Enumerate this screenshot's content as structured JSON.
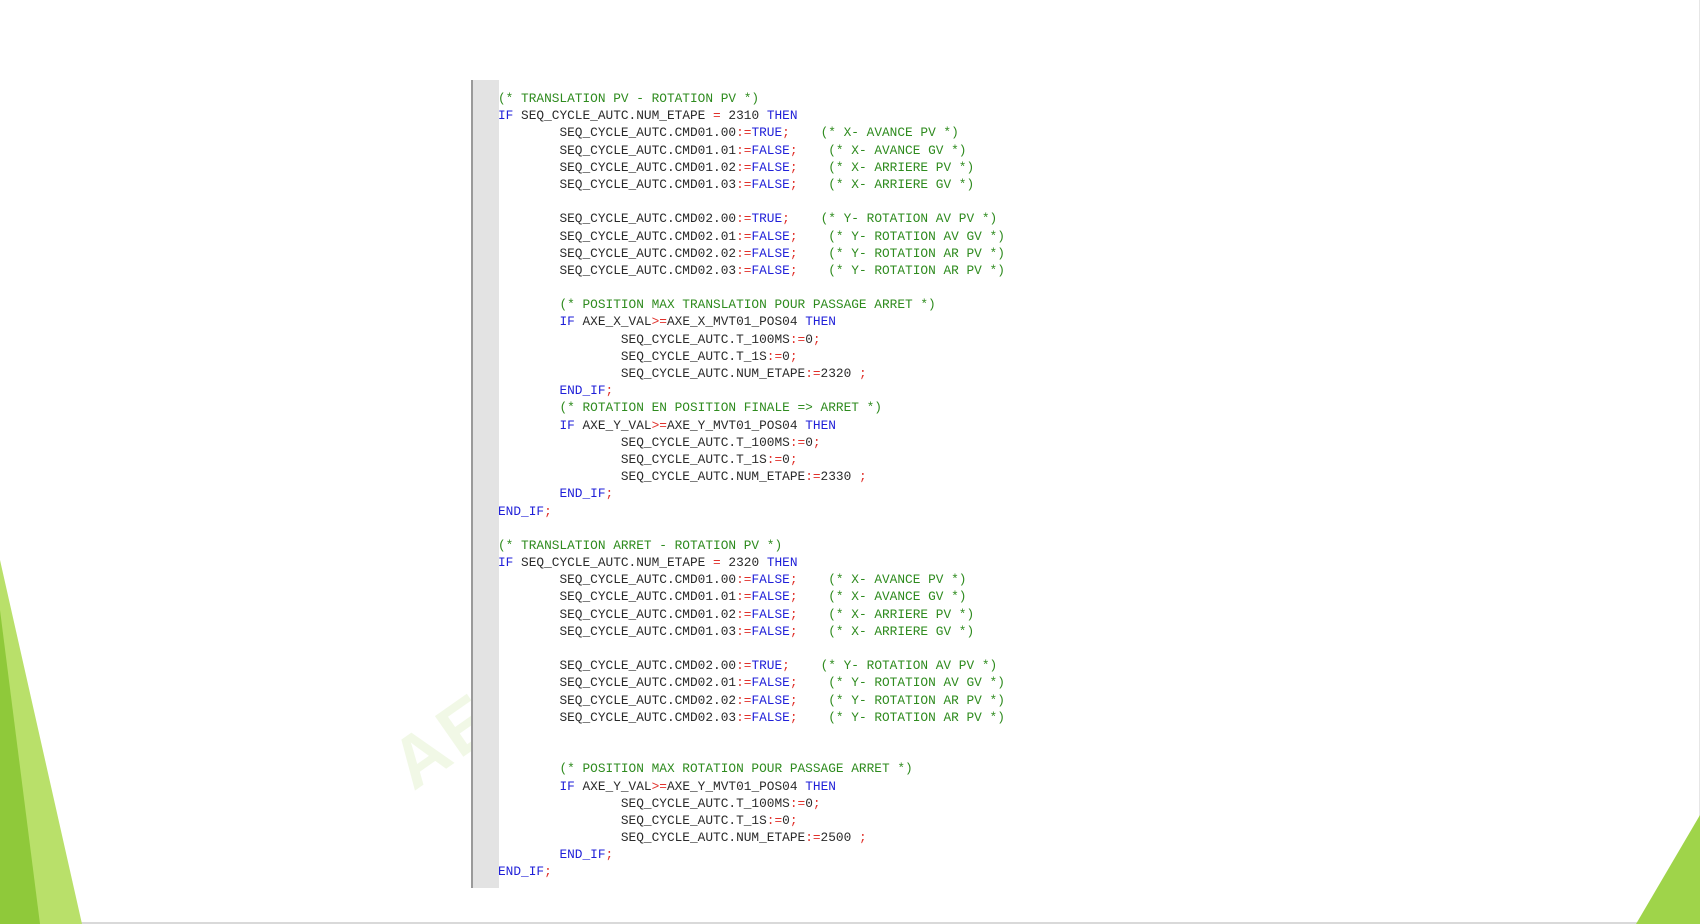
{
  "colors": {
    "comment": "#2e8b1e",
    "keyword": "#1f1fd8",
    "identifier": "#2a2a2a",
    "operator": "#e0302a",
    "accent_green": "#8fc93a",
    "gutter": "#e3e3e3"
  },
  "watermark": "AE",
  "code_lines": [
    {
      "tokens": [
        {
          "t": "cm",
          "v": "(* TRANSLATION PV - ROTATION PV *)"
        }
      ]
    },
    {
      "tokens": [
        {
          "t": "kw",
          "v": "IF"
        },
        {
          "t": "ws",
          "v": " "
        },
        {
          "t": "id",
          "v": "SEQ_CYCLE_AUTC.NUM_ETAPE"
        },
        {
          "t": "ws",
          "v": " "
        },
        {
          "t": "op",
          "v": "="
        },
        {
          "t": "ws",
          "v": " "
        },
        {
          "t": "num",
          "v": "2310"
        },
        {
          "t": "ws",
          "v": " "
        },
        {
          "t": "kw",
          "v": "THEN"
        }
      ]
    },
    {
      "tokens": [
        {
          "t": "ws",
          "v": "        "
        },
        {
          "t": "id",
          "v": "SEQ_CYCLE_AUTC.CMD01.00"
        },
        {
          "t": "op",
          "v": ":="
        },
        {
          "t": "bool",
          "v": "TRUE"
        },
        {
          "t": "pun",
          "v": ";"
        },
        {
          "t": "ws",
          "v": "    "
        },
        {
          "t": "cm",
          "v": "(* X- AVANCE PV *)"
        }
      ]
    },
    {
      "tokens": [
        {
          "t": "ws",
          "v": "        "
        },
        {
          "t": "id",
          "v": "SEQ_CYCLE_AUTC.CMD01.01"
        },
        {
          "t": "op",
          "v": ":="
        },
        {
          "t": "bool",
          "v": "FALSE"
        },
        {
          "t": "pun",
          "v": ";"
        },
        {
          "t": "ws",
          "v": "    "
        },
        {
          "t": "cm",
          "v": "(* X- AVANCE GV *)"
        }
      ]
    },
    {
      "tokens": [
        {
          "t": "ws",
          "v": "        "
        },
        {
          "t": "id",
          "v": "SEQ_CYCLE_AUTC.CMD01.02"
        },
        {
          "t": "op",
          "v": ":="
        },
        {
          "t": "bool",
          "v": "FALSE"
        },
        {
          "t": "pun",
          "v": ";"
        },
        {
          "t": "ws",
          "v": "    "
        },
        {
          "t": "cm",
          "v": "(* X- ARRIERE PV *)"
        }
      ]
    },
    {
      "tokens": [
        {
          "t": "ws",
          "v": "        "
        },
        {
          "t": "id",
          "v": "SEQ_CYCLE_AUTC.CMD01.03"
        },
        {
          "t": "op",
          "v": ":="
        },
        {
          "t": "bool",
          "v": "FALSE"
        },
        {
          "t": "pun",
          "v": ";"
        },
        {
          "t": "ws",
          "v": "    "
        },
        {
          "t": "cm",
          "v": "(* X- ARRIERE GV *)"
        }
      ]
    },
    {
      "tokens": []
    },
    {
      "tokens": [
        {
          "t": "ws",
          "v": "        "
        },
        {
          "t": "id",
          "v": "SEQ_CYCLE_AUTC.CMD02.00"
        },
        {
          "t": "op",
          "v": ":="
        },
        {
          "t": "bool",
          "v": "TRUE"
        },
        {
          "t": "pun",
          "v": ";"
        },
        {
          "t": "ws",
          "v": "    "
        },
        {
          "t": "cm",
          "v": "(* Y- ROTATION AV PV *)"
        }
      ]
    },
    {
      "tokens": [
        {
          "t": "ws",
          "v": "        "
        },
        {
          "t": "id",
          "v": "SEQ_CYCLE_AUTC.CMD02.01"
        },
        {
          "t": "op",
          "v": ":="
        },
        {
          "t": "bool",
          "v": "FALSE"
        },
        {
          "t": "pun",
          "v": ";"
        },
        {
          "t": "ws",
          "v": "    "
        },
        {
          "t": "cm",
          "v": "(* Y- ROTATION AV GV *)"
        }
      ]
    },
    {
      "tokens": [
        {
          "t": "ws",
          "v": "        "
        },
        {
          "t": "id",
          "v": "SEQ_CYCLE_AUTC.CMD02.02"
        },
        {
          "t": "op",
          "v": ":="
        },
        {
          "t": "bool",
          "v": "FALSE"
        },
        {
          "t": "pun",
          "v": ";"
        },
        {
          "t": "ws",
          "v": "    "
        },
        {
          "t": "cm",
          "v": "(* Y- ROTATION AR PV *)"
        }
      ]
    },
    {
      "tokens": [
        {
          "t": "ws",
          "v": "        "
        },
        {
          "t": "id",
          "v": "SEQ_CYCLE_AUTC.CMD02.03"
        },
        {
          "t": "op",
          "v": ":="
        },
        {
          "t": "bool",
          "v": "FALSE"
        },
        {
          "t": "pun",
          "v": ";"
        },
        {
          "t": "ws",
          "v": "    "
        },
        {
          "t": "cm",
          "v": "(* Y- ROTATION AR PV *)"
        }
      ]
    },
    {
      "tokens": []
    },
    {
      "tokens": [
        {
          "t": "ws",
          "v": "        "
        },
        {
          "t": "cm",
          "v": "(* POSITION MAX TRANSLATION POUR PASSAGE ARRET *)"
        }
      ]
    },
    {
      "tokens": [
        {
          "t": "ws",
          "v": "        "
        },
        {
          "t": "kw",
          "v": "IF"
        },
        {
          "t": "ws",
          "v": " "
        },
        {
          "t": "id",
          "v": "AXE_X_VAL"
        },
        {
          "t": "op",
          "v": ">="
        },
        {
          "t": "id",
          "v": "AXE_X_MVT01_POS04"
        },
        {
          "t": "ws",
          "v": " "
        },
        {
          "t": "kw",
          "v": "THEN"
        }
      ]
    },
    {
      "tokens": [
        {
          "t": "ws",
          "v": "                "
        },
        {
          "t": "id",
          "v": "SEQ_CYCLE_AUTC.T_100MS"
        },
        {
          "t": "op",
          "v": ":="
        },
        {
          "t": "num",
          "v": "0"
        },
        {
          "t": "pun",
          "v": ";"
        }
      ]
    },
    {
      "tokens": [
        {
          "t": "ws",
          "v": "                "
        },
        {
          "t": "id",
          "v": "SEQ_CYCLE_AUTC.T_1S"
        },
        {
          "t": "op",
          "v": ":="
        },
        {
          "t": "num",
          "v": "0"
        },
        {
          "t": "pun",
          "v": ";"
        }
      ]
    },
    {
      "tokens": [
        {
          "t": "ws",
          "v": "                "
        },
        {
          "t": "id",
          "v": "SEQ_CYCLE_AUTC.NUM_ETAPE"
        },
        {
          "t": "op",
          "v": ":="
        },
        {
          "t": "num",
          "v": "2320"
        },
        {
          "t": "ws",
          "v": " "
        },
        {
          "t": "pun",
          "v": ";"
        }
      ]
    },
    {
      "tokens": [
        {
          "t": "ws",
          "v": "        "
        },
        {
          "t": "kw",
          "v": "END_IF"
        },
        {
          "t": "pun",
          "v": ";"
        }
      ]
    },
    {
      "tokens": [
        {
          "t": "ws",
          "v": "        "
        },
        {
          "t": "cm",
          "v": "(* ROTATION EN POSITION FINALE => ARRET *)"
        }
      ]
    },
    {
      "tokens": [
        {
          "t": "ws",
          "v": "        "
        },
        {
          "t": "kw",
          "v": "IF"
        },
        {
          "t": "ws",
          "v": " "
        },
        {
          "t": "id",
          "v": "AXE_Y_VAL"
        },
        {
          "t": "op",
          "v": ">="
        },
        {
          "t": "id",
          "v": "AXE_Y_MVT01_POS04"
        },
        {
          "t": "ws",
          "v": " "
        },
        {
          "t": "kw",
          "v": "THEN"
        }
      ]
    },
    {
      "tokens": [
        {
          "t": "ws",
          "v": "                "
        },
        {
          "t": "id",
          "v": "SEQ_CYCLE_AUTC.T_100MS"
        },
        {
          "t": "op",
          "v": ":="
        },
        {
          "t": "num",
          "v": "0"
        },
        {
          "t": "pun",
          "v": ";"
        }
      ]
    },
    {
      "tokens": [
        {
          "t": "ws",
          "v": "                "
        },
        {
          "t": "id",
          "v": "SEQ_CYCLE_AUTC.T_1S"
        },
        {
          "t": "op",
          "v": ":="
        },
        {
          "t": "num",
          "v": "0"
        },
        {
          "t": "pun",
          "v": ";"
        }
      ]
    },
    {
      "tokens": [
        {
          "t": "ws",
          "v": "                "
        },
        {
          "t": "id",
          "v": "SEQ_CYCLE_AUTC.NUM_ETAPE"
        },
        {
          "t": "op",
          "v": ":="
        },
        {
          "t": "num",
          "v": "2330"
        },
        {
          "t": "ws",
          "v": " "
        },
        {
          "t": "pun",
          "v": ";"
        }
      ]
    },
    {
      "tokens": [
        {
          "t": "ws",
          "v": "        "
        },
        {
          "t": "kw",
          "v": "END_IF"
        },
        {
          "t": "pun",
          "v": ";"
        }
      ]
    },
    {
      "tokens": [
        {
          "t": "kw",
          "v": "END_IF"
        },
        {
          "t": "pun",
          "v": ";"
        }
      ]
    },
    {
      "tokens": []
    },
    {
      "tokens": [
        {
          "t": "cm",
          "v": "(* TRANSLATION ARRET - ROTATION PV *)"
        }
      ]
    },
    {
      "tokens": [
        {
          "t": "kw",
          "v": "IF"
        },
        {
          "t": "ws",
          "v": " "
        },
        {
          "t": "id",
          "v": "SEQ_CYCLE_AUTC.NUM_ETAPE"
        },
        {
          "t": "ws",
          "v": " "
        },
        {
          "t": "op",
          "v": "="
        },
        {
          "t": "ws",
          "v": " "
        },
        {
          "t": "num",
          "v": "2320"
        },
        {
          "t": "ws",
          "v": " "
        },
        {
          "t": "kw",
          "v": "THEN"
        }
      ]
    },
    {
      "tokens": [
        {
          "t": "ws",
          "v": "        "
        },
        {
          "t": "id",
          "v": "SEQ_CYCLE_AUTC.CMD01.00"
        },
        {
          "t": "op",
          "v": ":="
        },
        {
          "t": "bool",
          "v": "FALSE"
        },
        {
          "t": "pun",
          "v": ";"
        },
        {
          "t": "ws",
          "v": "    "
        },
        {
          "t": "cm",
          "v": "(* X- AVANCE PV *)"
        }
      ]
    },
    {
      "tokens": [
        {
          "t": "ws",
          "v": "        "
        },
        {
          "t": "id",
          "v": "SEQ_CYCLE_AUTC.CMD01.01"
        },
        {
          "t": "op",
          "v": ":="
        },
        {
          "t": "bool",
          "v": "FALSE"
        },
        {
          "t": "pun",
          "v": ";"
        },
        {
          "t": "ws",
          "v": "    "
        },
        {
          "t": "cm",
          "v": "(* X- AVANCE GV *)"
        }
      ]
    },
    {
      "tokens": [
        {
          "t": "ws",
          "v": "        "
        },
        {
          "t": "id",
          "v": "SEQ_CYCLE_AUTC.CMD01.02"
        },
        {
          "t": "op",
          "v": ":="
        },
        {
          "t": "bool",
          "v": "FALSE"
        },
        {
          "t": "pun",
          "v": ";"
        },
        {
          "t": "ws",
          "v": "    "
        },
        {
          "t": "cm",
          "v": "(* X- ARRIERE PV *)"
        }
      ]
    },
    {
      "tokens": [
        {
          "t": "ws",
          "v": "        "
        },
        {
          "t": "id",
          "v": "SEQ_CYCLE_AUTC.CMD01.03"
        },
        {
          "t": "op",
          "v": ":="
        },
        {
          "t": "bool",
          "v": "FALSE"
        },
        {
          "t": "pun",
          "v": ";"
        },
        {
          "t": "ws",
          "v": "    "
        },
        {
          "t": "cm",
          "v": "(* X- ARRIERE GV *)"
        }
      ]
    },
    {
      "tokens": []
    },
    {
      "tokens": [
        {
          "t": "ws",
          "v": "        "
        },
        {
          "t": "id",
          "v": "SEQ_CYCLE_AUTC.CMD02.00"
        },
        {
          "t": "op",
          "v": ":="
        },
        {
          "t": "bool",
          "v": "TRUE"
        },
        {
          "t": "pun",
          "v": ";"
        },
        {
          "t": "ws",
          "v": "    "
        },
        {
          "t": "cm",
          "v": "(* Y- ROTATION AV PV *)"
        }
      ]
    },
    {
      "tokens": [
        {
          "t": "ws",
          "v": "        "
        },
        {
          "t": "id",
          "v": "SEQ_CYCLE_AUTC.CMD02.01"
        },
        {
          "t": "op",
          "v": ":="
        },
        {
          "t": "bool",
          "v": "FALSE"
        },
        {
          "t": "pun",
          "v": ";"
        },
        {
          "t": "ws",
          "v": "    "
        },
        {
          "t": "cm",
          "v": "(* Y- ROTATION AV GV *)"
        }
      ]
    },
    {
      "tokens": [
        {
          "t": "ws",
          "v": "        "
        },
        {
          "t": "id",
          "v": "SEQ_CYCLE_AUTC.CMD02.02"
        },
        {
          "t": "op",
          "v": ":="
        },
        {
          "t": "bool",
          "v": "FALSE"
        },
        {
          "t": "pun",
          "v": ";"
        },
        {
          "t": "ws",
          "v": "    "
        },
        {
          "t": "cm",
          "v": "(* Y- ROTATION AR PV *)"
        }
      ]
    },
    {
      "tokens": [
        {
          "t": "ws",
          "v": "        "
        },
        {
          "t": "id",
          "v": "SEQ_CYCLE_AUTC.CMD02.03"
        },
        {
          "t": "op",
          "v": ":="
        },
        {
          "t": "bool",
          "v": "FALSE"
        },
        {
          "t": "pun",
          "v": ";"
        },
        {
          "t": "ws",
          "v": "    "
        },
        {
          "t": "cm",
          "v": "(* Y- ROTATION AR PV *)"
        }
      ]
    },
    {
      "tokens": []
    },
    {
      "tokens": []
    },
    {
      "tokens": [
        {
          "t": "ws",
          "v": "        "
        },
        {
          "t": "cm",
          "v": "(* POSITION MAX ROTATION POUR PASSAGE ARRET *)"
        }
      ]
    },
    {
      "tokens": [
        {
          "t": "ws",
          "v": "        "
        },
        {
          "t": "kw",
          "v": "IF"
        },
        {
          "t": "ws",
          "v": " "
        },
        {
          "t": "id",
          "v": "AXE_Y_VAL"
        },
        {
          "t": "op",
          "v": ">="
        },
        {
          "t": "id",
          "v": "AXE_Y_MVT01_POS04"
        },
        {
          "t": "ws",
          "v": " "
        },
        {
          "t": "kw",
          "v": "THEN"
        }
      ]
    },
    {
      "tokens": [
        {
          "t": "ws",
          "v": "                "
        },
        {
          "t": "id",
          "v": "SEQ_CYCLE_AUTC.T_100MS"
        },
        {
          "t": "op",
          "v": ":="
        },
        {
          "t": "num",
          "v": "0"
        },
        {
          "t": "pun",
          "v": ";"
        }
      ]
    },
    {
      "tokens": [
        {
          "t": "ws",
          "v": "                "
        },
        {
          "t": "id",
          "v": "SEQ_CYCLE_AUTC.T_1S"
        },
        {
          "t": "op",
          "v": ":="
        },
        {
          "t": "num",
          "v": "0"
        },
        {
          "t": "pun",
          "v": ";"
        }
      ]
    },
    {
      "tokens": [
        {
          "t": "ws",
          "v": "                "
        },
        {
          "t": "id",
          "v": "SEQ_CYCLE_AUTC.NUM_ETAPE"
        },
        {
          "t": "op",
          "v": ":="
        },
        {
          "t": "num",
          "v": "2500"
        },
        {
          "t": "ws",
          "v": " "
        },
        {
          "t": "pun",
          "v": ";"
        }
      ]
    },
    {
      "tokens": [
        {
          "t": "ws",
          "v": "        "
        },
        {
          "t": "kw",
          "v": "END_IF"
        },
        {
          "t": "pun",
          "v": ";"
        }
      ]
    },
    {
      "tokens": [
        {
          "t": "kw",
          "v": "END_IF"
        },
        {
          "t": "pun",
          "v": ";"
        }
      ]
    }
  ]
}
